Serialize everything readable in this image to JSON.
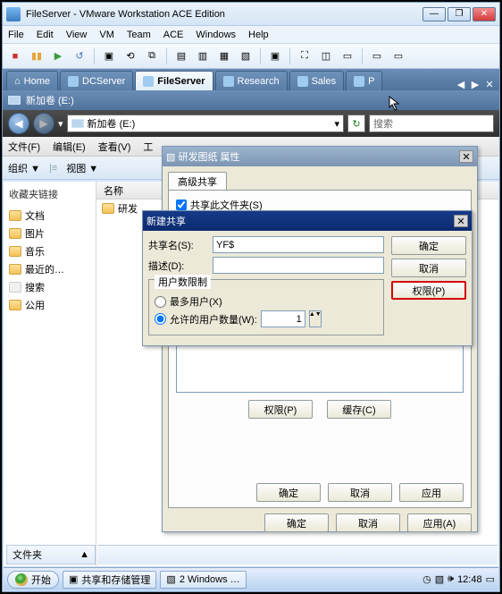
{
  "window": {
    "title": "FileServer - VMware Workstation ACE Edition",
    "minimize": "—",
    "maximize": "❐",
    "close": "✕"
  },
  "menubar": [
    "File",
    "Edit",
    "View",
    "VM",
    "Team",
    "ACE",
    "Windows",
    "Help"
  ],
  "tabs": {
    "home": "Home",
    "dcserver": "DCServer",
    "fileserver": "FileServer",
    "research": "Research",
    "sales": "Sales",
    "p": "P",
    "nav_prev": "◀",
    "nav_next": "▶",
    "nav_close": "✕"
  },
  "pathbar": {
    "label": "新加卷 (E:)"
  },
  "nav": {
    "back": "◀",
    "fwd": "▶",
    "drop": "▾",
    "address": "新加卷 (E:)",
    "addr_drop": "▾",
    "refresh": "↻",
    "search_placeholder": "搜索"
  },
  "graymenu": {
    "file": "文件(F)",
    "edit": "编辑(E)",
    "view": "查看(V)",
    "tools": "工"
  },
  "orgbar": {
    "organize": "组织",
    "views": "视图",
    "drop": "▼"
  },
  "sidebar": {
    "header": "收藏夹链接",
    "items": [
      "文档",
      "图片",
      "音乐",
      "最近的…",
      "搜索",
      "公用"
    ]
  },
  "listing": {
    "col_name": "名称",
    "row0": "研发"
  },
  "folders_label": "文件夹",
  "folders_chevron": "▲",
  "prop_dialog": {
    "title": "研发图纸 属性",
    "tab": "高级共享",
    "share_checkbox": "共享此文件夹(S)",
    "perms_btn": "权限(P)",
    "cache_btn": "缓存(C)",
    "ok": "确定",
    "cancel": "取消",
    "apply": "应用"
  },
  "newshare": {
    "title": "新建共享",
    "close": "✕",
    "sharename_label": "共享名(S):",
    "sharename_value": "YF$",
    "desc_label": "描述(D):",
    "desc_value": "",
    "limit_group": "用户数限制",
    "max_users": "最多用户(X)",
    "allowed_users": "允许的用户数量(W):",
    "count": "1",
    "ok": "确定",
    "cancel": "取消",
    "perms": "权限(P)"
  },
  "bottom_buttons": {
    "ok": "确定",
    "cancel": "取消",
    "apply": "应用(A)"
  },
  "taskbar": {
    "start": "开始",
    "task1": "共享和存储管理",
    "task2": "2 Windows …",
    "clock": "12:48"
  }
}
